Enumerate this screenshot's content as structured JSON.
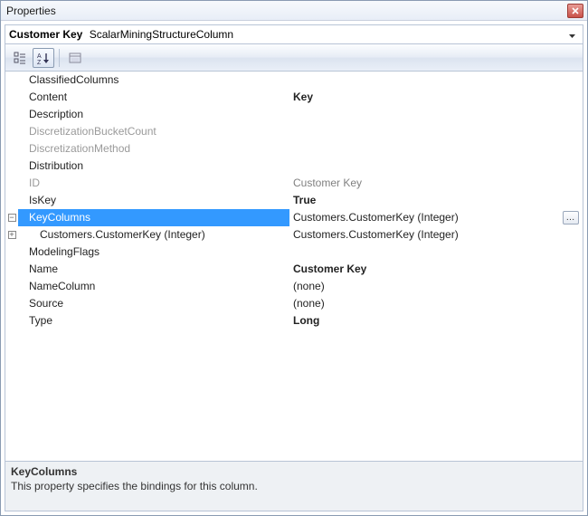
{
  "window": {
    "title": "Properties"
  },
  "object": {
    "name": "Customer Key",
    "type": "ScalarMiningStructureColumn"
  },
  "selected_key": "KeyColumns",
  "properties": [
    {
      "key": "ClassifiedColumns",
      "label": "ClassifiedColumns",
      "value": "",
      "bold": false,
      "disabled": false,
      "expandable": false
    },
    {
      "key": "Content",
      "label": "Content",
      "value": "Key",
      "bold": true,
      "disabled": false,
      "expandable": false
    },
    {
      "key": "Description",
      "label": "Description",
      "value": "",
      "bold": false,
      "disabled": false,
      "expandable": false
    },
    {
      "key": "DiscretizationBucketCount",
      "label": "DiscretizationBucketCount",
      "value": "",
      "bold": false,
      "disabled": true,
      "expandable": false
    },
    {
      "key": "DiscretizationMethod",
      "label": "DiscretizationMethod",
      "value": "",
      "bold": false,
      "disabled": true,
      "expandable": false
    },
    {
      "key": "Distribution",
      "label": "Distribution",
      "value": "",
      "bold": false,
      "disabled": false,
      "expandable": false
    },
    {
      "key": "ID",
      "label": "ID",
      "value": "Customer Key",
      "bold": false,
      "disabled": true,
      "expandable": false,
      "value_disabled": true
    },
    {
      "key": "IsKey",
      "label": "IsKey",
      "value": "True",
      "bold": true,
      "disabled": false,
      "expandable": false
    },
    {
      "key": "KeyColumns",
      "label": "KeyColumns",
      "value": "Customers.CustomerKey (Integer)",
      "bold": false,
      "disabled": false,
      "expandable": true,
      "expanded": true,
      "selected": true,
      "has_ellipsis": true,
      "children": [
        {
          "key": "KeyColumns.0",
          "label": "Customers.CustomerKey (Integer)",
          "value": "Customers.CustomerKey (Integer)",
          "bold": false,
          "expandable": true,
          "expanded": false
        }
      ]
    },
    {
      "key": "ModelingFlags",
      "label": "ModelingFlags",
      "value": "",
      "bold": false,
      "disabled": false,
      "expandable": false
    },
    {
      "key": "Name",
      "label": "Name",
      "value": "Customer Key",
      "bold": true,
      "disabled": false,
      "expandable": false
    },
    {
      "key": "NameColumn",
      "label": "NameColumn",
      "value": "(none)",
      "bold": false,
      "disabled": false,
      "expandable": false
    },
    {
      "key": "Source",
      "label": "Source",
      "value": "(none)",
      "bold": false,
      "disabled": false,
      "expandable": false
    },
    {
      "key": "Type",
      "label": "Type",
      "value": "Long",
      "bold": true,
      "disabled": false,
      "expandable": false
    }
  ],
  "description": {
    "title": "KeyColumns",
    "text": "This property specifies the bindings for this column."
  },
  "toolbar": {
    "categorized_tip": "Categorized",
    "alpha_tip": "Alphabetical",
    "pages_tip": "Property Pages"
  }
}
